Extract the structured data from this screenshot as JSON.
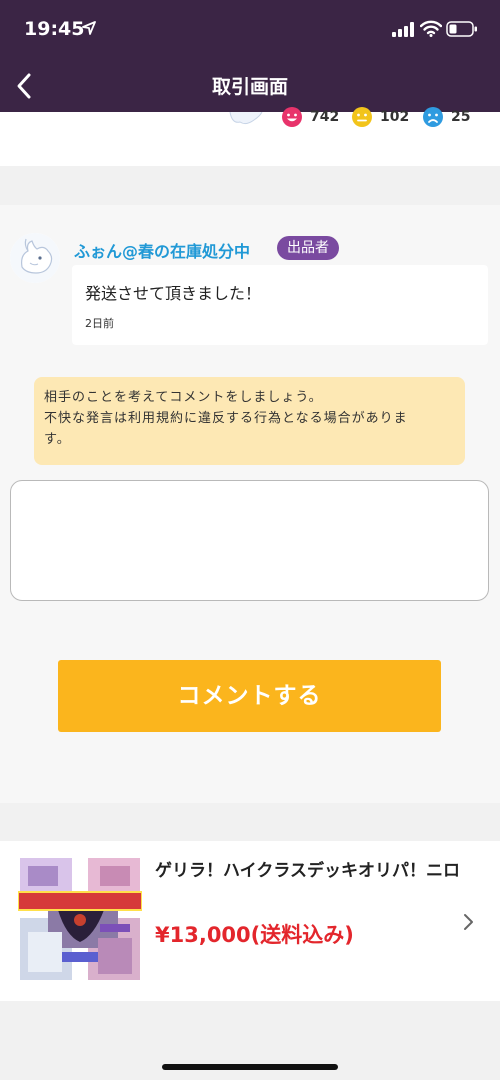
{
  "status_bar": {
    "time": "19:45"
  },
  "nav": {
    "title": "取引画面"
  },
  "ratings": [
    {
      "icon": "happy-face-icon",
      "count": "742",
      "color": "#e8336b"
    },
    {
      "icon": "neutral-face-icon",
      "count": "102",
      "color": "#f2c41b"
    },
    {
      "icon": "sad-face-icon",
      "count": "25",
      "color": "#2f9be0"
    }
  ],
  "comment": {
    "username": "ふぉん@春の在庫処分中",
    "badge": "出品者",
    "text": "発送させて頂きました！",
    "time": "2日前"
  },
  "notice": {
    "line1": "相手のことを考えてコメントをしましょう。",
    "line2": "不快な発言は利用規約に違反する行為となる場合がありま",
    "line3": "す。"
  },
  "comment_input": {
    "value": "",
    "placeholder": ""
  },
  "submit_label": "コメントする",
  "product": {
    "name": "ゲリラ！ハイクラスデッキオリパ！ニロ",
    "price": "¥13,000(送料込み)",
    "thumb_banner": "ゲリラ！ハイクラスデッキオリパ！"
  },
  "colors": {
    "header": "#3b2545",
    "link_blue": "#2199d6",
    "badge_purple": "#7a4aa0",
    "notice_bg": "#fde8b4",
    "button": "#fbb51d",
    "price": "#e3262c"
  }
}
